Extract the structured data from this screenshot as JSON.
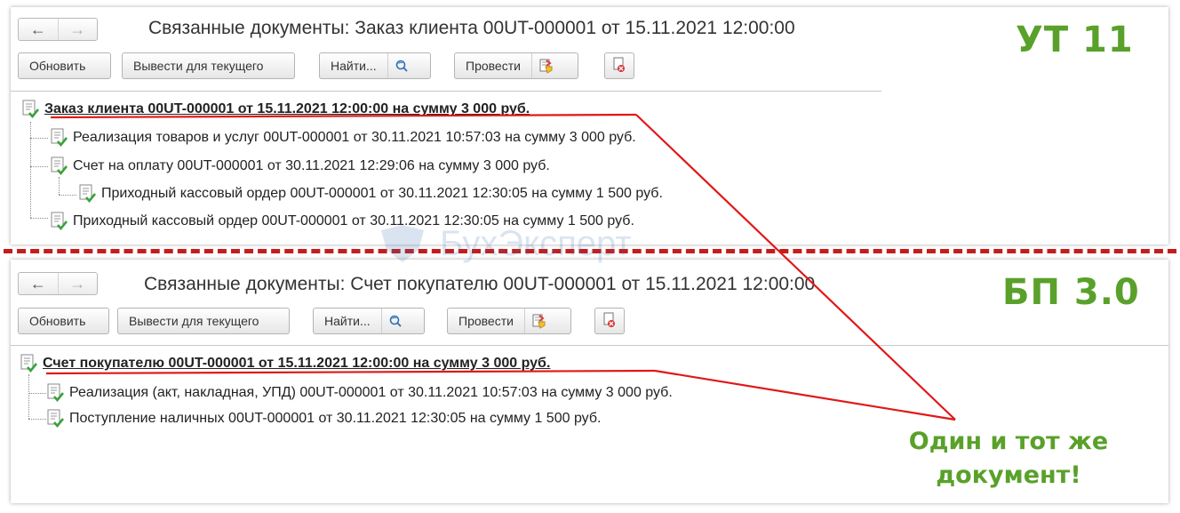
{
  "panels": {
    "top": {
      "window_title": "Связанные документы: Заказ клиента 00UT-000001 от 15.11.2021 12:00:00",
      "toolbar": {
        "refresh_label": "Обновить",
        "show_current_label": "Вывести для текущего",
        "find_label": "Найти...",
        "post_label": "Провести"
      },
      "tree": {
        "root": "Заказ клиента 00UT-000001 от 15.11.2021 12:00:00 на сумму 3 000 руб.",
        "items": [
          "Реализация товаров и услуг 00UT-000001 от 30.11.2021 10:57:03 на сумму 3 000 руб.",
          "Счет на оплату 00UT-000001 от 30.11.2021 12:29:06 на сумму 3 000 руб.",
          "Приходный кассовый ордер 00UT-000001 от 30.11.2021 12:30:05 на сумму 1 500 руб.",
          "Приходный кассовый ордер 00UT-000001 от 30.11.2021 12:30:05 на сумму 1 500 руб."
        ]
      }
    },
    "bottom": {
      "window_title": "Связанные документы: Счет покупателю 00UT-000001 от 15.11.2021 12:00:00",
      "toolbar": {
        "refresh_label": "Обновить",
        "show_current_label": "Вывести для текущего",
        "find_label": "Найти...",
        "post_label": "Провести"
      },
      "tree": {
        "root": "Счет покупателю 00UT-000001 от 15.11.2021 12:00:00 на сумму 3 000 руб.",
        "items": [
          "Реализация (акт, накладная, УПД) 00UT-000001 от 30.11.2021 10:57:03 на сумму 3 000 руб.",
          "Поступление наличных 00UT-000001 от 30.11.2021 12:30:05 на сумму 1 500 руб."
        ]
      }
    }
  },
  "badges": {
    "top": "УТ 11",
    "bottom": "БП 3.0"
  },
  "annotation": {
    "line1": "Один и тот же",
    "line2": "документ!"
  },
  "watermark": {
    "text": "БухЭксперт"
  },
  "icons": {
    "back": "arrow-left-icon",
    "forward": "arrow-right-icon",
    "find_extra": "search-refresh-icon",
    "post_extra": "post-document-icon",
    "delete": "delete-mark-icon",
    "document": "document-posted-icon"
  },
  "colors": {
    "badge_green": "#59a12a",
    "annotation_red": "#e01818",
    "divider_red": "#c21e1e"
  }
}
